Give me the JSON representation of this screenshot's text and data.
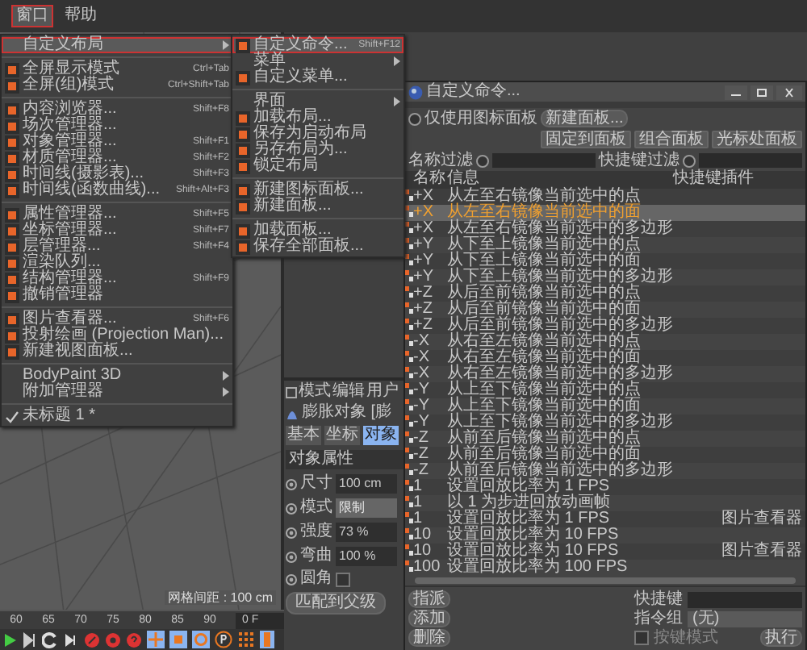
{
  "menubar": [
    {
      "label": "窗口",
      "selected": true
    },
    {
      "label": "帮助",
      "selected": false
    }
  ],
  "window_menu": [
    {
      "kind": "item",
      "label": "自定义布局",
      "icon": false,
      "submenu": true,
      "selected": true
    },
    {
      "kind": "separator"
    },
    {
      "kind": "item",
      "label": "全屏显示模式",
      "shortcut": "Ctrl+Tab",
      "icon": true,
      "submenu": false,
      "selected": false
    },
    {
      "kind": "item",
      "label": "全屏(组)模式",
      "shortcut": "Ctrl+Shift+Tab",
      "icon": true,
      "submenu": false,
      "selected": false
    },
    {
      "kind": "separator"
    },
    {
      "kind": "item",
      "label": "内容浏览器...",
      "shortcut": "Shift+F8",
      "icon": true,
      "submenu": false,
      "selected": false
    },
    {
      "kind": "item",
      "label": "场次管理器...",
      "icon": true,
      "submenu": false,
      "selected": false
    },
    {
      "kind": "item",
      "label": "对象管理器...",
      "shortcut": "Shift+F1",
      "icon": true,
      "submenu": false,
      "selected": false
    },
    {
      "kind": "item",
      "label": "材质管理器...",
      "shortcut": "Shift+F2",
      "icon": true,
      "submenu": false,
      "selected": false
    },
    {
      "kind": "item",
      "label": "时间线(摄影表)...",
      "shortcut": "Shift+F3",
      "icon": true,
      "submenu": false,
      "selected": false
    },
    {
      "kind": "item",
      "label": "时间线(函数曲线)...",
      "shortcut": "Shift+Alt+F3",
      "icon": true,
      "submenu": false,
      "selected": false
    },
    {
      "kind": "separator"
    },
    {
      "kind": "item",
      "label": "属性管理器...",
      "shortcut": "Shift+F5",
      "icon": true,
      "submenu": false,
      "selected": false
    },
    {
      "kind": "item",
      "label": "坐标管理器...",
      "shortcut": "Shift+F7",
      "icon": true,
      "submenu": false,
      "selected": false
    },
    {
      "kind": "item",
      "label": "层管理器...",
      "shortcut": "Shift+F4",
      "icon": true,
      "submenu": false,
      "selected": false
    },
    {
      "kind": "item",
      "label": "渲染队列...",
      "icon": true,
      "submenu": false,
      "selected": false
    },
    {
      "kind": "item",
      "label": "结构管理器...",
      "shortcut": "Shift+F9",
      "icon": true,
      "submenu": false,
      "selected": false
    },
    {
      "kind": "item",
      "label": "撤销管理器",
      "icon": true,
      "submenu": false,
      "selected": false
    },
    {
      "kind": "separator"
    },
    {
      "kind": "item",
      "label": "图片查看器...",
      "shortcut": "Shift+F6",
      "icon": true,
      "submenu": false,
      "selected": false
    },
    {
      "kind": "item",
      "label": "投射绘画 (Projection Man)...",
      "icon": true,
      "submenu": false,
      "selected": false
    },
    {
      "kind": "item",
      "label": "新建视图面板...",
      "icon": true,
      "submenu": false,
      "selected": false
    },
    {
      "kind": "separator"
    },
    {
      "kind": "item",
      "label": "BodyPaint 3D",
      "icon": false,
      "submenu": true,
      "selected": false
    },
    {
      "kind": "item",
      "label": "附加管理器",
      "icon": false,
      "submenu": true,
      "selected": false
    },
    {
      "kind": "separator"
    },
    {
      "kind": "check",
      "label": "未标题 1 *",
      "checked": true
    }
  ],
  "layout_submenu": [
    {
      "kind": "item",
      "label": "自定义命令...",
      "shortcut": "Shift+F12",
      "icon": true,
      "submenu": false,
      "selected": true
    },
    {
      "kind": "item",
      "label": "菜单",
      "icon": false,
      "submenu": true,
      "selected": false
    },
    {
      "kind": "item",
      "label": "自定义菜单...",
      "icon": true,
      "submenu": false,
      "selected": false
    },
    {
      "kind": "separator"
    },
    {
      "kind": "item",
      "label": "界面",
      "icon": false,
      "submenu": true,
      "selected": false
    },
    {
      "kind": "item",
      "label": "加载布局...",
      "icon": true,
      "submenu": false,
      "selected": false
    },
    {
      "kind": "item",
      "label": "保存为启动布局",
      "icon": true,
      "submenu": false,
      "selected": false
    },
    {
      "kind": "item",
      "label": "另存布局为...",
      "icon": true,
      "submenu": false,
      "selected": false
    },
    {
      "kind": "item",
      "label": "锁定布局",
      "icon": true,
      "submenu": false,
      "selected": false
    },
    {
      "kind": "separator"
    },
    {
      "kind": "item",
      "label": "新建图标面板...",
      "icon": true,
      "submenu": false,
      "selected": false
    },
    {
      "kind": "item",
      "label": "新建面板...",
      "icon": true,
      "submenu": false,
      "selected": false
    },
    {
      "kind": "separator"
    },
    {
      "kind": "item",
      "label": "加载面板...",
      "icon": true,
      "submenu": false,
      "selected": false
    },
    {
      "kind": "item",
      "label": "保存全部面板...",
      "icon": true,
      "submenu": false,
      "selected": false
    }
  ],
  "viewport": {
    "grid_label": "网格间距 : 100 cm"
  },
  "attributes": {
    "menu": [
      "模式",
      "编辑",
      "用户"
    ],
    "object": "膨胀对象 [膨",
    "tabs": [
      {
        "label": "基本",
        "selected": false
      },
      {
        "label": "坐标",
        "selected": false
      },
      {
        "label": "对象",
        "selected": true
      }
    ],
    "section": "对象属性",
    "fields": [
      {
        "kind": "number",
        "label": "尺寸",
        "value": "100 cm"
      },
      {
        "kind": "dropdown",
        "label": "模式",
        "value": "限制"
      },
      {
        "kind": "number",
        "label": "强度",
        "value": "73 %"
      },
      {
        "kind": "number",
        "label": "弯曲",
        "value": "100 %"
      },
      {
        "kind": "checkbox",
        "label": "圆角",
        "checked": false
      }
    ],
    "button": "匹配到父级"
  },
  "timeline": {
    "ticks": [
      "60",
      "65",
      "70",
      "75",
      "80",
      "85",
      "90"
    ],
    "frame": "0 F"
  },
  "dialog": {
    "title": "自定义命令...",
    "palette_only": {
      "label": "仅使用图标面板",
      "checked": false
    },
    "new_palette": "新建面板...",
    "right_buttons": [
      "固定到面板",
      "组合面板",
      "光标处面板"
    ],
    "filters": [
      {
        "label": "名称过滤",
        "checked": false
      },
      {
        "label": "快捷键过滤",
        "checked": false
      }
    ],
    "columns": [
      "名称",
      "信息",
      "快捷键",
      "插件"
    ],
    "rows": [
      {
        "name": "+X",
        "info": "从左至右镜像当前选中的点",
        "selected": false
      },
      {
        "name": "+X",
        "info": "从左至右镜像当前选中的面",
        "selected": true
      },
      {
        "name": "+X",
        "info": "从左至右镜像当前选中的多边形",
        "selected": false
      },
      {
        "name": "+Y",
        "info": "从下至上镜像当前选中的点",
        "selected": false
      },
      {
        "name": "+Y",
        "info": "从下至上镜像当前选中的面",
        "selected": false
      },
      {
        "name": "+Y",
        "info": "从下至上镜像当前选中的多边形",
        "selected": false
      },
      {
        "name": "+Z",
        "info": "从后至前镜像当前选中的点",
        "selected": false
      },
      {
        "name": "+Z",
        "info": "从后至前镜像当前选中的面",
        "selected": false
      },
      {
        "name": "+Z",
        "info": "从后至前镜像当前选中的多边形",
        "selected": false
      },
      {
        "name": "-X",
        "info": "从右至左镜像当前选中的点",
        "selected": false
      },
      {
        "name": "-X",
        "info": "从右至左镜像当前选中的面",
        "selected": false
      },
      {
        "name": "-X",
        "info": "从右至左镜像当前选中的多边形",
        "selected": false
      },
      {
        "name": "-Y",
        "info": "从上至下镜像当前选中的点",
        "selected": false
      },
      {
        "name": "-Y",
        "info": "从上至下镜像当前选中的面",
        "selected": false
      },
      {
        "name": "-Y",
        "info": "从上至下镜像当前选中的多边形",
        "selected": false
      },
      {
        "name": "-Z",
        "info": "从前至后镜像当前选中的点",
        "selected": false
      },
      {
        "name": "-Z",
        "info": "从前至后镜像当前选中的面",
        "selected": false
      },
      {
        "name": "-Z",
        "info": "从前至后镜像当前选中的多边形",
        "selected": false
      },
      {
        "name": "1",
        "info": "设置回放比率为 1 FPS",
        "selected": false
      },
      {
        "name": "1",
        "info": "以 1 为步进回放动画帧",
        "selected": false
      },
      {
        "name": "1",
        "info": "设置回放比率为 1 FPS",
        "plugin": "图片查看器",
        "selected": false
      },
      {
        "name": "10",
        "info": "设置回放比率为 10 FPS",
        "selected": false
      },
      {
        "name": "10",
        "info": "设置回放比率为 10 FPS",
        "plugin": "图片查看器",
        "selected": false
      },
      {
        "name": "100",
        "info": "设置回放比率为 100 FPS",
        "selected": false
      }
    ],
    "shortcut_label": "快捷键",
    "group_label": "指令组",
    "group_value": "(无)",
    "key_mode": {
      "label": "按键模式",
      "checked": false
    },
    "side_buttons": [
      "指派",
      "添加",
      "删除"
    ],
    "execute": "执行"
  }
}
